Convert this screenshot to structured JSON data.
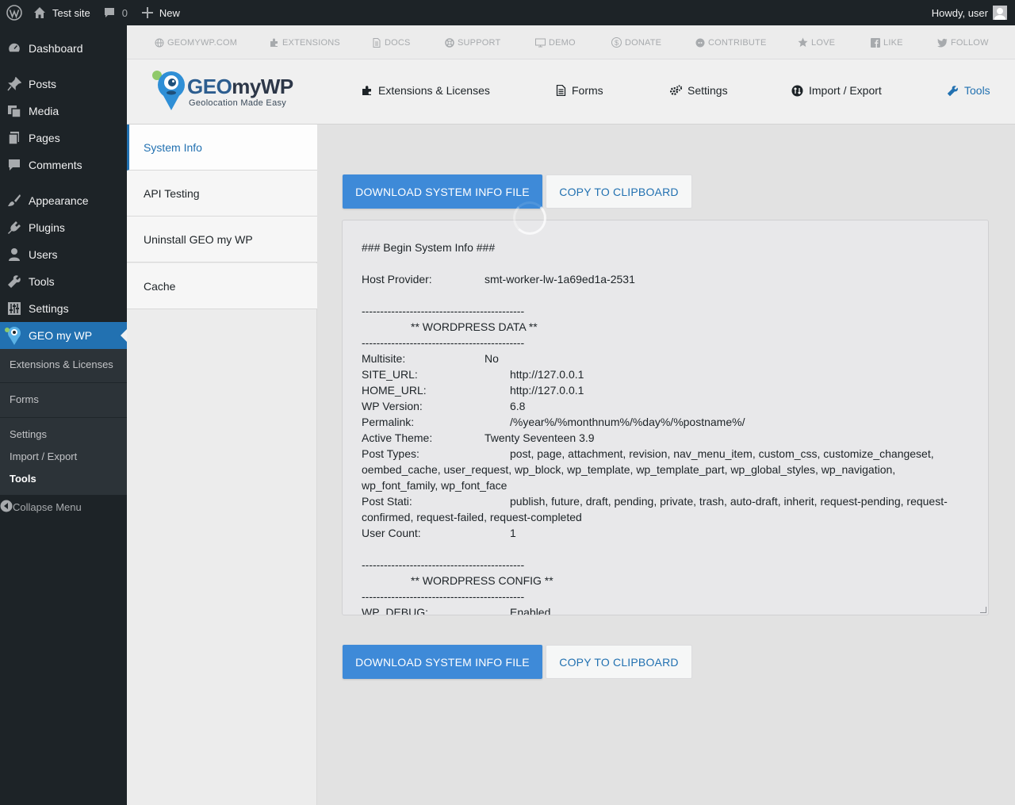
{
  "adminbar": {
    "site_name": "Test site",
    "comments_count": "0",
    "new_label": "New",
    "howdy": "Howdy, user"
  },
  "menu": {
    "dashboard": "Dashboard",
    "posts": "Posts",
    "media": "Media",
    "pages": "Pages",
    "comments": "Comments",
    "appearance": "Appearance",
    "plugins": "Plugins",
    "users": "Users",
    "tools": "Tools",
    "settings": "Settings",
    "geomywp": "GEO my WP",
    "sub": {
      "extensions": "Extensions & Licenses",
      "forms": "Forms",
      "settings": "Settings",
      "import_export": "Import / Export",
      "tools": "Tools"
    },
    "collapse": "Collapse Menu"
  },
  "toplinks": [
    "GEOMYWP.COM",
    "EXTENSIONS",
    "DOCS",
    "SUPPORT",
    "DEMO",
    "DONATE",
    "CONTRIBUTE",
    "LOVE",
    "LIKE",
    "FOLLOW"
  ],
  "logo": {
    "title_a": "GEO",
    "title_b": "myWP",
    "subtitle": "Geolocation Made Easy"
  },
  "nav": {
    "extensions": "Extensions & Licenses",
    "forms": "Forms",
    "settings": "Settings",
    "import_export": "Import / Export",
    "tools": "Tools"
  },
  "tabs": [
    "System Info",
    "API Testing",
    "Uninstall GEO my WP",
    "Cache"
  ],
  "buttons": {
    "download": "DOWNLOAD SYSTEM INFO FILE",
    "copy": "COPY TO CLIPBOARD"
  },
  "sysinfo": {
    "begin": "### Begin System Info ###",
    "host_label": "Host Provider:",
    "host_value": "smt-worker-lw-1a69ed1a-2531",
    "divider": "--------------------------------------------",
    "wp_data_header": "** WORDPRESS DATA **",
    "rows": {
      "multisite_k": "Multisite:",
      "multisite_v": "No",
      "site_url_k": "SITE_URL:",
      "site_url_v": "http://127.0.0.1",
      "home_url_k": "HOME_URL:",
      "home_url_v": "http://127.0.0.1",
      "wp_version_k": "WP Version:",
      "wp_version_v": "6.8",
      "permalink_k": "Permalink:",
      "permalink_v": "/%year%/%monthnum%/%day%/%postname%/",
      "theme_k": "Active Theme:",
      "theme_v": "Twenty Seventeen 3.9",
      "post_types_k": "Post Types:",
      "post_types_v1": "post, page, attachment, revision, nav_menu_item, custom_css, customize_changeset,",
      "post_types_v2": "oembed_cache, user_request, wp_block, wp_template, wp_template_part, wp_global_styles, wp_navigation,",
      "post_types_v3": "wp_font_family, wp_font_face",
      "post_stati_k": "Post Stati:",
      "post_stati_v1": "publish, future, draft, pending, private, trash, auto-draft, inherit, request-pending, request-",
      "post_stati_v2": "confirmed, request-failed, request-completed",
      "user_count_k": "User Count:",
      "user_count_v": "1"
    },
    "wp_config_header": "** WORDPRESS CONFIG **",
    "wp_debug_k": "WP_DEBUG:",
    "wp_debug_v": "Enabled"
  },
  "colors": {
    "accent": "#2271b1",
    "button": "#3e8ad8",
    "adminbar": "#1d2327"
  }
}
